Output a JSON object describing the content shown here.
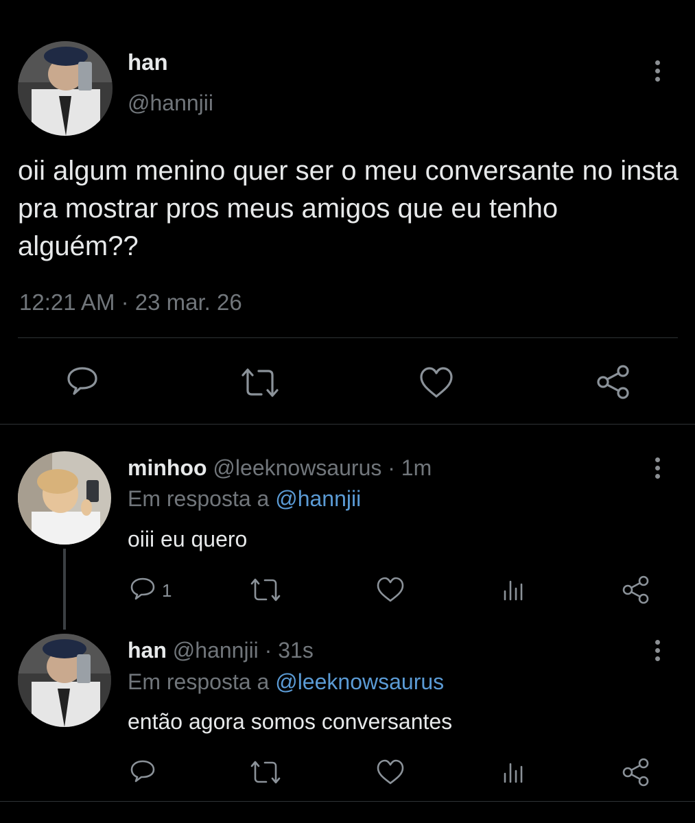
{
  "main_tweet": {
    "display_name": "han",
    "handle": "@hannjii",
    "text": "oii algum menino quer ser o meu conversante no insta pra mostrar pros meus amigos que eu tenho alguém??",
    "timestamp": "12:21 AM · 23 mar. 26"
  },
  "replies": [
    {
      "display_name": "minhoo",
      "handle": "@leeknowsaurus",
      "time": "· 1m",
      "replying_label": "Em resposta a",
      "replying_to": "@hannjii",
      "text": "oiii eu quero",
      "reply_count": "1"
    },
    {
      "display_name": "han",
      "handle": "@hannjii",
      "time": "· 31s",
      "replying_label": "Em resposta a",
      "replying_to": "@leeknowsaurus",
      "text": "então agora somos conversantes",
      "reply_count": ""
    }
  ],
  "icons": [
    "more-vertical-icon",
    "reply-icon",
    "retweet-icon",
    "like-icon",
    "share-icon",
    "analytics-icon"
  ],
  "colors": {
    "background": "#000000",
    "text": "#e7e9ea",
    "muted": "#71767b",
    "link": "#5b9bd5",
    "divider": "#2f3336"
  }
}
